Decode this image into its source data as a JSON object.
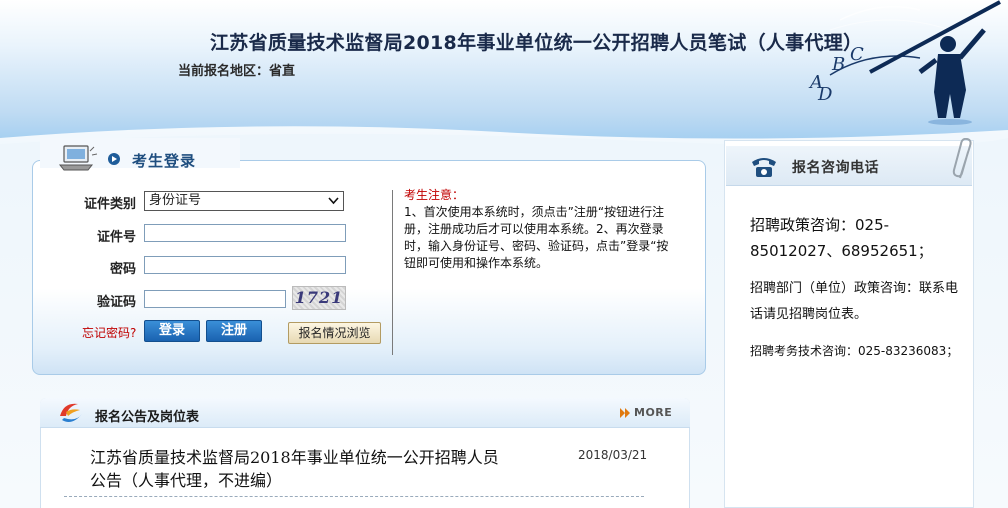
{
  "header": {
    "title": "江苏省质量技术监督局2018年事业单位统一公开招聘人员笔试（人事代理）",
    "region": "当前报名地区：省直",
    "art_letters": [
      "A",
      "B",
      "C",
      "D"
    ]
  },
  "login": {
    "title": "考生登录",
    "id_type_label": "证件类别",
    "id_type_value": "身份证号",
    "id_number_label": "证件号",
    "password_label": "密码",
    "captcha_label": "验证码",
    "captcha_text": "1721",
    "forgot_link": "忘记密码?",
    "login_button": "登录",
    "register_button": "注册",
    "browse_button": "报名情况浏览",
    "notice_title": "考生注意：",
    "notice_text": "1、首次使用本系统时，须点击”注册“按钮进行注册，注册成功后才可以使用本系统。2、再次登录时，输入身份证号、密码、验证码，点击”登录“按钮即可使用和操作本系统。"
  },
  "announcements": {
    "title": "报名公告及岗位表",
    "more_label": "MORE",
    "items": [
      {
        "title": "江苏省质量技术监督局2018年事业单位统一公开招聘人员公告（人事代理，不进编）",
        "date": "2018/03/21"
      }
    ]
  },
  "consult": {
    "title": "报名咨询电话",
    "policy": "招聘政策咨询：025-85012027、68952651；",
    "department": "招聘部门（单位）政策咨询：联系电话请见招聘岗位表。",
    "tech": "招聘考务技术咨询：025-83236083；"
  },
  "colors": {
    "accent": "#1f4e7f",
    "button_blue": "#1a62b0",
    "alert_red": "#c00000"
  }
}
